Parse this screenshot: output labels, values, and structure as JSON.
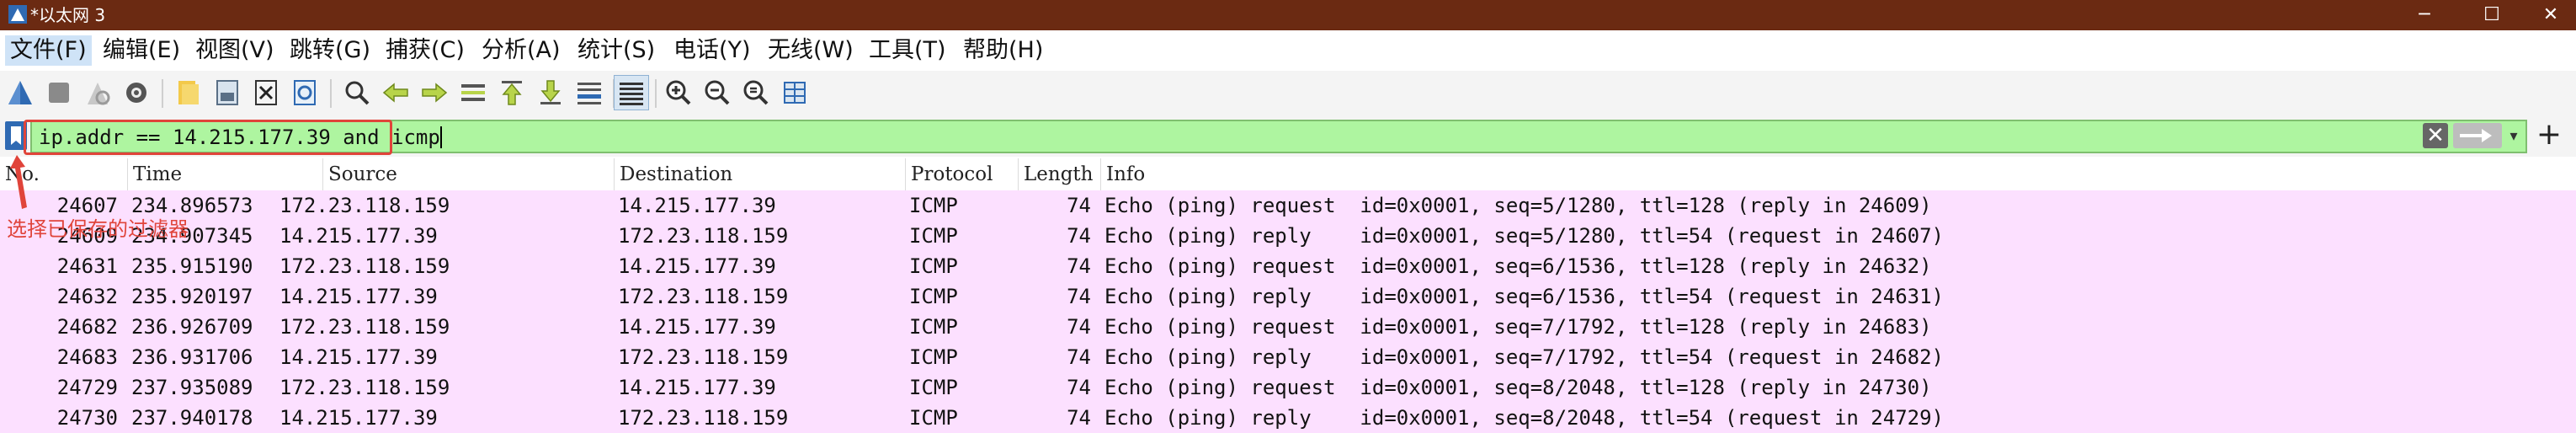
{
  "window": {
    "title": "*以太网 3",
    "minimize": "─",
    "maximize": "☐",
    "close": "✕"
  },
  "menu": [
    {
      "label": "文件(F)",
      "active": true
    },
    {
      "label": "编辑(E)"
    },
    {
      "label": "视图(V)"
    },
    {
      "label": "跳转(G)"
    },
    {
      "label": "捕获(C)"
    },
    {
      "label": "分析(A)"
    },
    {
      "label": "统计(S)"
    },
    {
      "label": "电话(Y)"
    },
    {
      "label": "无线(W)"
    },
    {
      "label": "工具(T)"
    },
    {
      "label": "帮助(H)"
    }
  ],
  "toolbar": {
    "icons": [
      "shark-fin-start-icon",
      "stop-capture-icon",
      "restart-capture-icon",
      "capture-options-icon",
      "open-file-icon",
      "save-file-icon",
      "close-file-icon",
      "reload-file-icon",
      "find-packet-icon",
      "go-back-icon",
      "go-forward-icon",
      "go-to-packet-icon",
      "go-first-packet-icon",
      "go-last-packet-icon",
      "auto-scroll-icon",
      "colorize-icon",
      "zoom-in-icon",
      "zoom-out-icon",
      "zoom-normal-icon",
      "resize-columns-icon"
    ],
    "accent": "#2f6ab3"
  },
  "filter": {
    "value": "ip.addr == 14.215.177.39 and icmp",
    "background": "#aef5a0",
    "clear_label": "✕",
    "add_label": "+"
  },
  "annotation": {
    "text": "选择已保存的过滤器",
    "color": "#e0443a"
  },
  "columns": {
    "no": "No.",
    "time": "Time",
    "source": "Source",
    "destination": "Destination",
    "protocol": "Protocol",
    "length": "Length",
    "info": "Info"
  },
  "row_color": "#fce0ff",
  "packets": [
    {
      "no": "24607",
      "time": "234.896573",
      "source": "172.23.118.159",
      "destination": "14.215.177.39",
      "protocol": "ICMP",
      "length": "74",
      "info": "Echo (ping) request  id=0x0001, seq=5/1280, ttl=128 (reply in 24609)"
    },
    {
      "no": "24609",
      "time": "234.907345",
      "source": "14.215.177.39",
      "destination": "172.23.118.159",
      "protocol": "ICMP",
      "length": "74",
      "info": "Echo (ping) reply    id=0x0001, seq=5/1280, ttl=54 (request in 24607)"
    },
    {
      "no": "24631",
      "time": "235.915190",
      "source": "172.23.118.159",
      "destination": "14.215.177.39",
      "protocol": "ICMP",
      "length": "74",
      "info": "Echo (ping) request  id=0x0001, seq=6/1536, ttl=128 (reply in 24632)"
    },
    {
      "no": "24632",
      "time": "235.920197",
      "source": "14.215.177.39",
      "destination": "172.23.118.159",
      "protocol": "ICMP",
      "length": "74",
      "info": "Echo (ping) reply    id=0x0001, seq=6/1536, ttl=54 (request in 24631)"
    },
    {
      "no": "24682",
      "time": "236.926709",
      "source": "172.23.118.159",
      "destination": "14.215.177.39",
      "protocol": "ICMP",
      "length": "74",
      "info": "Echo (ping) request  id=0x0001, seq=7/1792, ttl=128 (reply in 24683)"
    },
    {
      "no": "24683",
      "time": "236.931706",
      "source": "14.215.177.39",
      "destination": "172.23.118.159",
      "protocol": "ICMP",
      "length": "74",
      "info": "Echo (ping) reply    id=0x0001, seq=7/1792, ttl=54 (request in 24682)"
    },
    {
      "no": "24729",
      "time": "237.935089",
      "source": "172.23.118.159",
      "destination": "14.215.177.39",
      "protocol": "ICMP",
      "length": "74",
      "info": "Echo (ping) request  id=0x0001, seq=8/2048, ttl=128 (reply in 24730)"
    },
    {
      "no": "24730",
      "time": "237.940178",
      "source": "14.215.177.39",
      "destination": "172.23.118.159",
      "protocol": "ICMP",
      "length": "74",
      "info": "Echo (ping) reply    id=0x0001, seq=8/2048, ttl=54 (request in 24729)"
    }
  ]
}
